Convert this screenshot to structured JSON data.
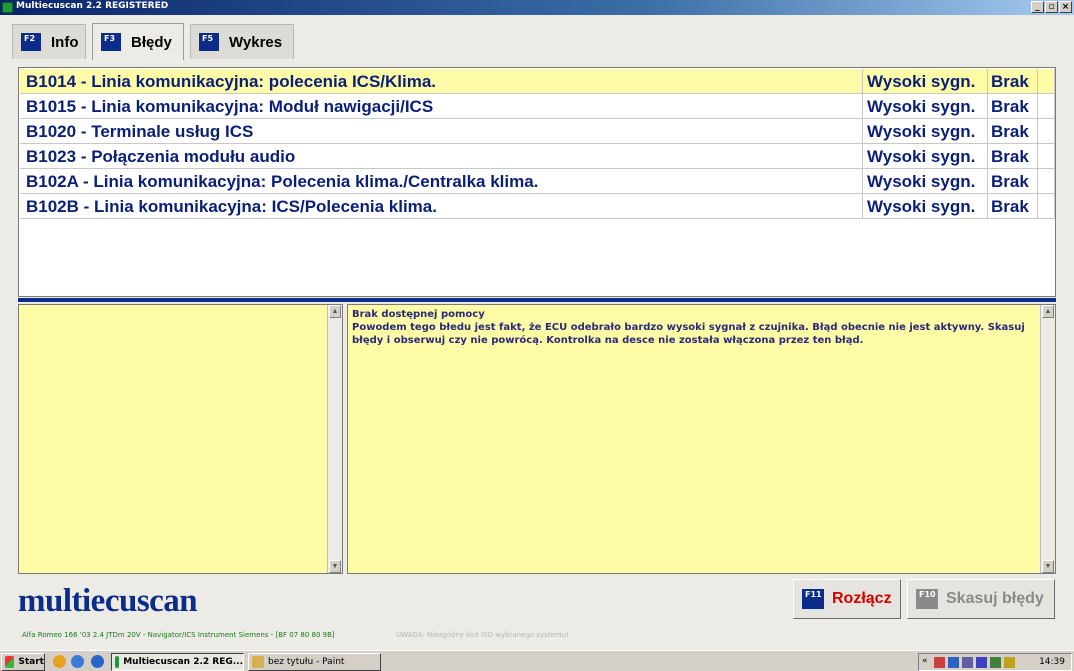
{
  "window": {
    "title": "Multiecuscan 2.2 REGISTERED",
    "minimize": "_",
    "maximize": "▫",
    "close": "×"
  },
  "tabs": [
    {
      "key": "F2",
      "label": "Info",
      "active": false
    },
    {
      "key": "F3",
      "label": "Błędy",
      "active": true
    },
    {
      "key": "F5",
      "label": "Wykres",
      "active": false
    }
  ],
  "errors": [
    {
      "code_desc": "B1014 - Linia komunikacyjna: polecenia ICS/Klima.",
      "status": "Wysoki sygn.",
      "state": "Brak",
      "selected": true
    },
    {
      "code_desc": "B1015 - Linia komunikacyjna: Moduł nawigacji/ICS",
      "status": "Wysoki sygn.",
      "state": "Brak",
      "selected": false
    },
    {
      "code_desc": "B1020 - Terminale usług ICS",
      "status": "Wysoki sygn.",
      "state": "Brak",
      "selected": false
    },
    {
      "code_desc": "B1023 - Połączenia modułu audio",
      "status": "Wysoki sygn.",
      "state": "Brak",
      "selected": false
    },
    {
      "code_desc": "B102A - Linia komunikacyjna: Polecenia klima./Centralka klima.",
      "status": "Wysoki sygn.",
      "state": "Brak",
      "selected": false
    },
    {
      "code_desc": "B102B - Linia komunikacyjna: ICS/Polecenia klima.",
      "status": "Wysoki sygn.",
      "state": "Brak",
      "selected": false
    }
  ],
  "help": {
    "heading": "Brak dostępnej pomocy",
    "text": "Powodem tego błedu jest fakt, że ECU odebrało bardzo wysoki sygnał z czujnika. Błąd obecnie nie jest aktywny. Skasuj błędy i obserwuj czy nie powrócą. Kontrolka na desce nie została włączona przez ten błąd."
  },
  "logo": "multiecuscan",
  "buttons": {
    "disconnect": {
      "key": "F11",
      "label": "Rozłącz",
      "color": "#d40000"
    },
    "clear": {
      "key": "F10",
      "label": "Skasuj błędy",
      "color": "#8a8a8a"
    }
  },
  "status": {
    "vehicle": "Alfa Romeo 166 '03 2.4 JTDm 20V - Navigator/ICS Instrument Siemens - [BF 07 80 80 9B]",
    "warning": "UWAGA: Niezgodny kod ISO wybranego systemu!"
  },
  "taskbar": {
    "start": "Start",
    "items": [
      {
        "label": "Multiecuscan 2.2 REG...",
        "active": true
      },
      {
        "label": "bez tytułu - Paint",
        "active": false
      }
    ],
    "tray_arrow": "«",
    "clock": "14:39"
  }
}
